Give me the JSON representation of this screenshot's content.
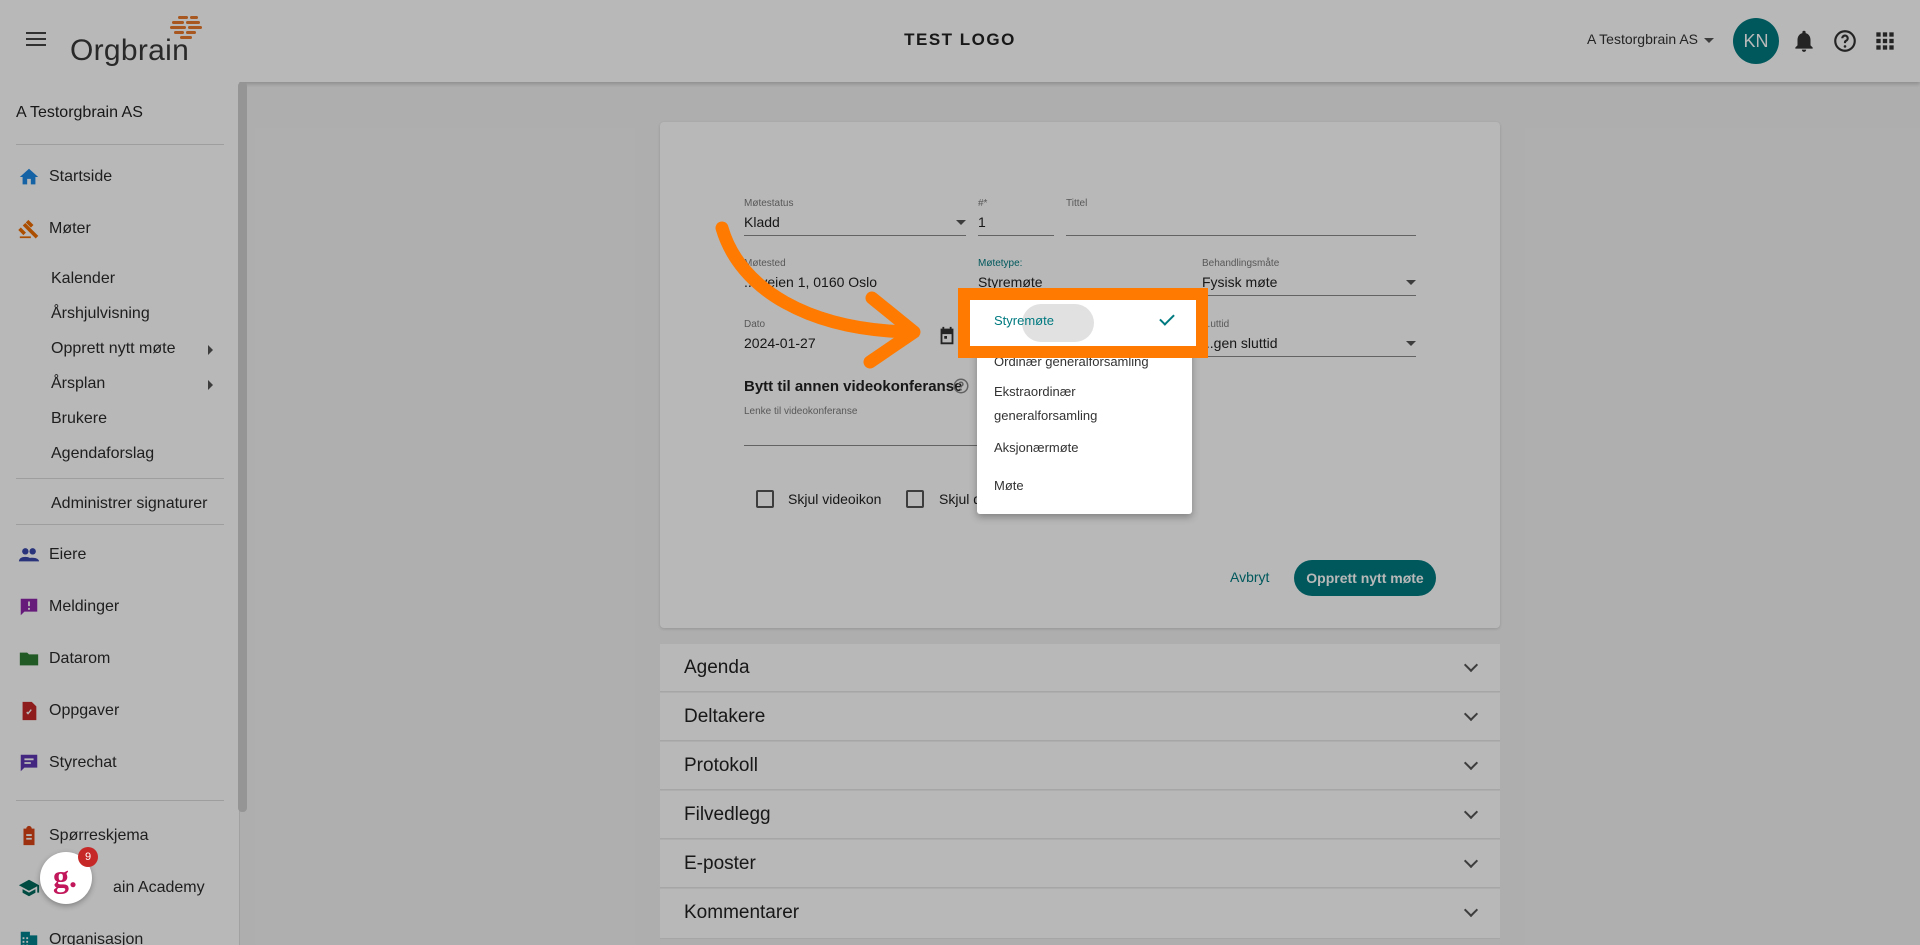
{
  "header": {
    "brand": "Orgbrain",
    "center_title": "TEST LOGO",
    "org_selector": "A Testorgbrain AS",
    "avatar_initials": "KN",
    "icons": [
      "menu-icon",
      "bell-icon",
      "help-icon",
      "apps-grid-icon"
    ]
  },
  "sidebar": {
    "org_name": "A Testorgbrain AS",
    "items": [
      {
        "label": "Startside",
        "icon": "home-icon"
      },
      {
        "label": "Møter",
        "icon": "gavel-icon"
      },
      {
        "label": "Eiere",
        "icon": "people-icon"
      },
      {
        "label": "Meldinger",
        "icon": "message-icon"
      },
      {
        "label": "Datarom",
        "icon": "folder-icon"
      },
      {
        "label": "Oppgaver",
        "icon": "task-icon"
      },
      {
        "label": "Styrechat",
        "icon": "chat-icon"
      },
      {
        "label": "Spørreskjema",
        "icon": "clipboard-icon"
      },
      {
        "label": "ain Academy",
        "icon": "school-icon"
      },
      {
        "label": "Organisasjon",
        "icon": "building-icon"
      }
    ],
    "sub_items": [
      {
        "label": "Kalender"
      },
      {
        "label": "Årshjulvisning"
      },
      {
        "label": "Opprett nytt møte"
      },
      {
        "label": "Årsplan"
      },
      {
        "label": "Brukere"
      },
      {
        "label": "Agendaforslag"
      },
      {
        "label": "Administrer signaturer"
      }
    ]
  },
  "form": {
    "motestatus_label": "Møtestatus",
    "motestatus_value": "Kladd",
    "number_label": "#*",
    "number_value": "1",
    "tittel_label": "Tittel",
    "motested_label": "Møtested",
    "motested_value": "...rveien 1, 0160 Oslo",
    "motetype_label": "Møtetype:",
    "motetype_value": "Styremøte",
    "behandlingsmate_label": "Behandlingsmåte",
    "behandlingsmate_value": "Fysisk møte",
    "dato_label": "Dato",
    "dato_value": "2024-01-27",
    "sluttid_label": "...uttid",
    "sluttid_value": "...gen sluttid",
    "video_heading": "Bytt til annen videokonferanse",
    "video_link_label": "Lenke til videokonferanse",
    "checkbox1": "Skjul videoikon",
    "checkbox2": "Skjul d",
    "cancel": "Avbryt",
    "submit": "Opprett nytt møte"
  },
  "dropdown": {
    "selected": "Styremøte",
    "options": [
      "Ordinær generalforsamling",
      "Ekstraordinær",
      "generalforsamling",
      "Aksjonærmøte",
      "Møte"
    ]
  },
  "accordions": [
    "Agenda",
    "Deltakere",
    "Protokoll",
    "Filvedlegg",
    "E-poster",
    "Kommentarer"
  ],
  "fab_badge_count": "9",
  "colors": {
    "accent": "#007a80",
    "highlight": "#ff7a00"
  }
}
